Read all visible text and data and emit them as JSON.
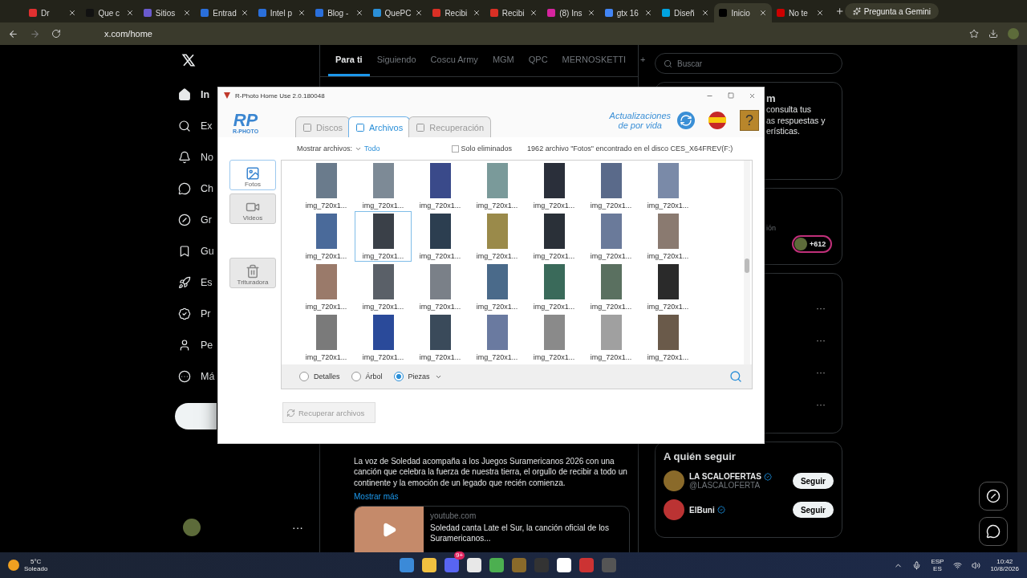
{
  "browser": {
    "tabs": [
      {
        "label": "Dr",
        "selected": false
      },
      {
        "label": "Que c",
        "selected": false
      },
      {
        "label": "Sitios",
        "selected": false
      },
      {
        "label": "Entrad",
        "selected": false
      },
      {
        "label": "Intel p",
        "selected": false
      },
      {
        "label": "Blog -",
        "selected": false
      },
      {
        "label": "QuePC",
        "selected": false
      },
      {
        "label": "Recibi",
        "selected": false
      },
      {
        "label": "Recibi",
        "selected": false
      },
      {
        "label": "(8) Ins",
        "selected": false
      },
      {
        "label": "gtx 16",
        "selected": false
      },
      {
        "label": "Diseñ",
        "selected": false
      },
      {
        "label": "Inicio",
        "selected": true
      },
      {
        "label": "No te",
        "selected": false
      }
    ],
    "gemini": "Pregunta a Gemini",
    "url": "x.com/home"
  },
  "nav": {
    "items": [
      {
        "label": "In",
        "selected": true
      },
      {
        "label": "Ex",
        "selected": false
      },
      {
        "label": "No",
        "selected": false
      },
      {
        "label": "Ch",
        "selected": false
      },
      {
        "label": "Gr",
        "selected": false
      },
      {
        "label": "Gu",
        "selected": false
      },
      {
        "label": "Es",
        "selected": false
      },
      {
        "label": "Pr",
        "selected": false
      },
      {
        "label": "Pe",
        "selected": false
      },
      {
        "label": "Má",
        "selected": false
      }
    ]
  },
  "feed": {
    "tabs": [
      {
        "label": "Para ti",
        "selected": true
      },
      {
        "label": "Siguiendo",
        "selected": false
      },
      {
        "label": "Coscu Army",
        "selected": false
      },
      {
        "label": "MGM",
        "selected": false
      },
      {
        "label": "QPC",
        "selected": false
      },
      {
        "label": "MERNOSKETTI",
        "selected": false
      }
    ],
    "add": "+",
    "post": {
      "text": "La voz de Soledad acompaña a los  Juegos Suramericanos 2026 con una canción que celebra la fuerza de nuestra tierra, el orgullo de recibir a todo un continente y la emoción de un legado que recién comienza.",
      "more": "Mostrar más",
      "card_site": "youtube.com",
      "card_title": "Soledad canta Late el Sur, la canción oficial de los Suramericanos..."
    }
  },
  "right": {
    "search_placeholder": "Buscar",
    "premium": {
      "heading": "m",
      "lines": [
        "consulta tus",
        "as respuestas y",
        "erísticas."
      ]
    },
    "live": {
      "caption": "ión",
      "count": "+612"
    },
    "trends_more": [
      "···",
      "···",
      "···",
      "···"
    ],
    "follow": {
      "title": "A quién seguir",
      "accounts": [
        {
          "name": "LA SCALOFERTAS",
          "handle": "@LASCALOFERTA",
          "button": "Seguir"
        },
        {
          "name": "ElBuni",
          "button": "Seguir"
        }
      ]
    }
  },
  "profile_more": "···",
  "dialog": {
    "title": "R-Photo Home Use 2.0.180048",
    "logo_mark": "RP",
    "logo": "R-PHOTO",
    "help": "?",
    "tabs": [
      {
        "label": "Discos",
        "selected": false
      },
      {
        "label": "Archivos",
        "selected": true
      },
      {
        "label": "Recuperación",
        "selected": false
      }
    ],
    "updates": [
      "Actualizaciones",
      "de por vida"
    ],
    "filter_label": "Mostrar archivos:",
    "filter_value": "Todo",
    "only_deleted": {
      "label": "Solo eliminados",
      "checked": false
    },
    "status": "1962 archivo \"Fotos\" encontrado en el disco CES_X64FREV(F:)",
    "categories": [
      {
        "label": "Fotos",
        "selected": true
      },
      {
        "label": "Videos",
        "selected": false
      },
      {
        "label": "Trituradora",
        "selected": false
      }
    ],
    "files": [
      {
        "label": "img_720x1...",
        "selected": false
      },
      {
        "label": "img_720x1...",
        "selected": false
      },
      {
        "label": "img_720x1...",
        "selected": false
      },
      {
        "label": "img_720x1...",
        "selected": false
      },
      {
        "label": "img_720x1...",
        "selected": false
      },
      {
        "label": "img_720x1...",
        "selected": false
      },
      {
        "label": "img_720x1...",
        "selected": false
      },
      {
        "label": "img_720x1...",
        "selected": false
      },
      {
        "label": "img_720x1...",
        "selected": true
      },
      {
        "label": "img_720x1...",
        "selected": false
      },
      {
        "label": "img_720x1...",
        "selected": false
      },
      {
        "label": "img_720x1...",
        "selected": false
      },
      {
        "label": "img_720x1...",
        "selected": false
      },
      {
        "label": "img_720x1...",
        "selected": false
      },
      {
        "label": "img_720x1...",
        "selected": false
      },
      {
        "label": "img_720x1...",
        "selected": false
      },
      {
        "label": "img_720x1...",
        "selected": false
      },
      {
        "label": "img_720x1...",
        "selected": false
      },
      {
        "label": "img_720x1...",
        "selected": false
      },
      {
        "label": "img_720x1...",
        "selected": false
      },
      {
        "label": "img_720x1...",
        "selected": false
      },
      {
        "label": "img_720x1...",
        "selected": false
      },
      {
        "label": "img_720x1...",
        "selected": false
      },
      {
        "label": "img_720x1...",
        "selected": false
      },
      {
        "label": "img_720x1...",
        "selected": false
      },
      {
        "label": "img_720x1...",
        "selected": false
      },
      {
        "label": "img_720x1...",
        "selected": false
      },
      {
        "label": "img_720x1...",
        "selected": false
      }
    ],
    "views": [
      {
        "label": "Detalles",
        "selected": false
      },
      {
        "label": "Árbol",
        "selected": false
      },
      {
        "label": "Piezas",
        "selected": true
      }
    ],
    "recover": {
      "label": "Recuperar archivos",
      "disabled": true
    }
  },
  "taskbar": {
    "temp": "5°C",
    "weather": "Soleado",
    "lang": [
      "ESP",
      "ES"
    ],
    "time": "10:42",
    "date": "10/8/2026",
    "discord_badge": "9+"
  }
}
